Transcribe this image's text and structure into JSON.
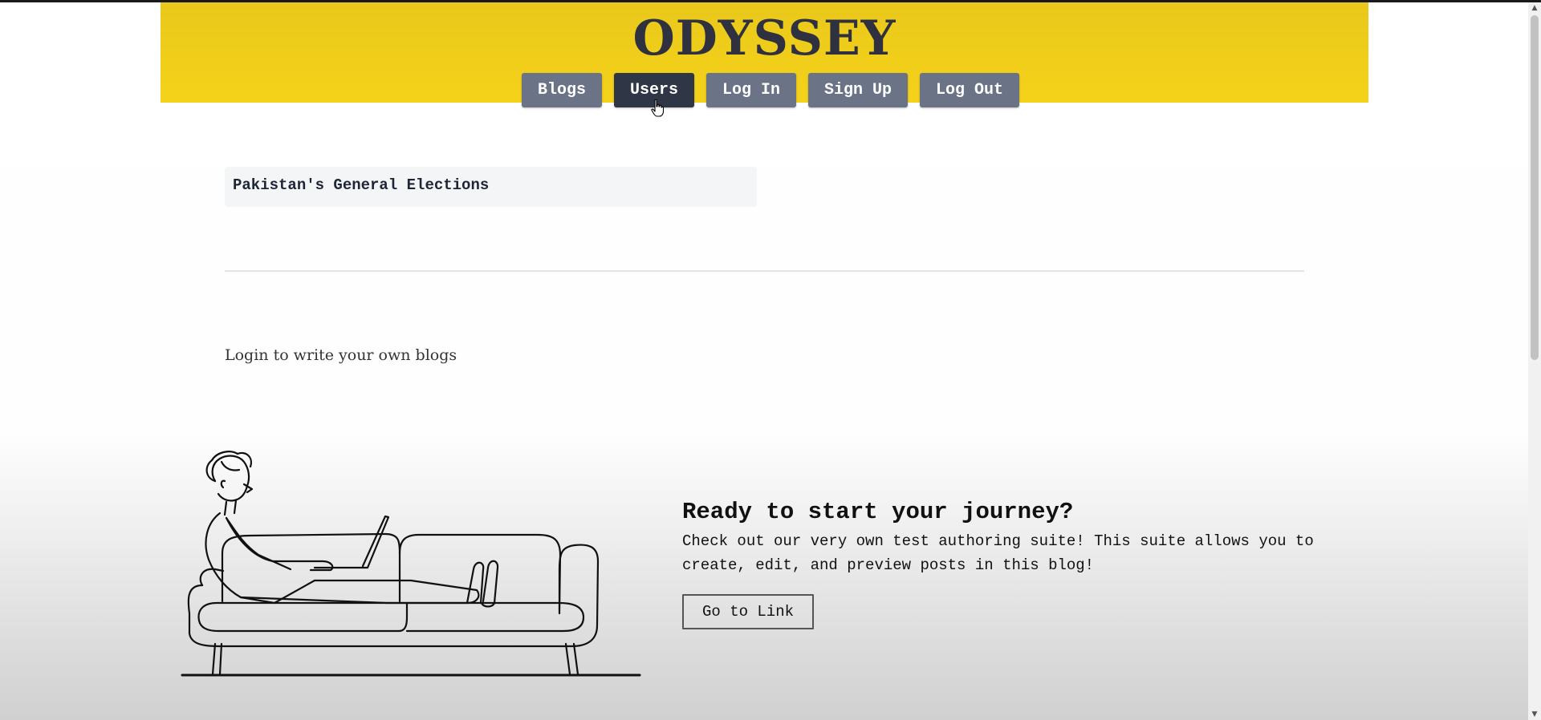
{
  "header": {
    "logo": "ODYSSEY"
  },
  "nav": {
    "items": [
      {
        "label": "Blogs"
      },
      {
        "label": "Users"
      },
      {
        "label": "Log In"
      },
      {
        "label": "Sign Up"
      },
      {
        "label": "Log Out"
      }
    ],
    "active": "Users"
  },
  "posts": [
    {
      "title": "Pakistan's General Elections"
    }
  ],
  "login_note": "Login to write your own blogs",
  "cta": {
    "title": "Ready to start your journey?",
    "text": "Check out our very own test authoring suite! This suite allows you to create, edit, and preview posts in this blog!",
    "button": "Go to Link"
  },
  "colors": {
    "header_bg": "#f2cf1b",
    "nav_btn": "#6b7487",
    "nav_btn_active": "#2f3646",
    "logo": "#2f3140"
  },
  "icons": {
    "cursor": "hand-pointer-icon",
    "scroll_up": "up-arrow-icon",
    "scroll_down": "down-arrow-icon"
  }
}
